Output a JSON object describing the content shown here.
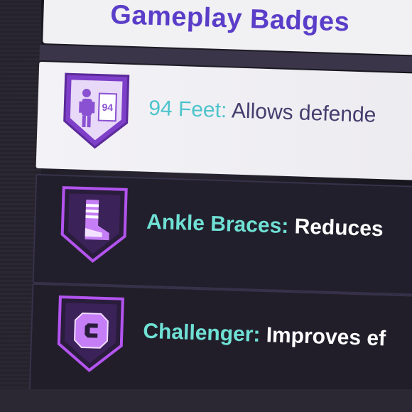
{
  "header": {
    "title": "Gameplay Badges"
  },
  "badges": [
    {
      "name": "94 Feet",
      "separator": ":",
      "description": " Allows defende",
      "icon": "defender-badge-icon",
      "selected": true
    },
    {
      "name": "Ankle Braces",
      "separator": ":",
      "description": " Reduces",
      "icon": "ankle-brace-badge-icon",
      "selected": false
    },
    {
      "name": "Challenger",
      "separator": ":",
      "description": " Improves ef",
      "icon": "challenger-badge-icon",
      "selected": false
    }
  ],
  "colors": {
    "accent": "#5a3dc8",
    "badge_purple": "#a24de0",
    "badge_name_teal": "#6fe0d4",
    "selected_row_bg": "#f1f0f3",
    "row_bg": "#221f2c"
  }
}
